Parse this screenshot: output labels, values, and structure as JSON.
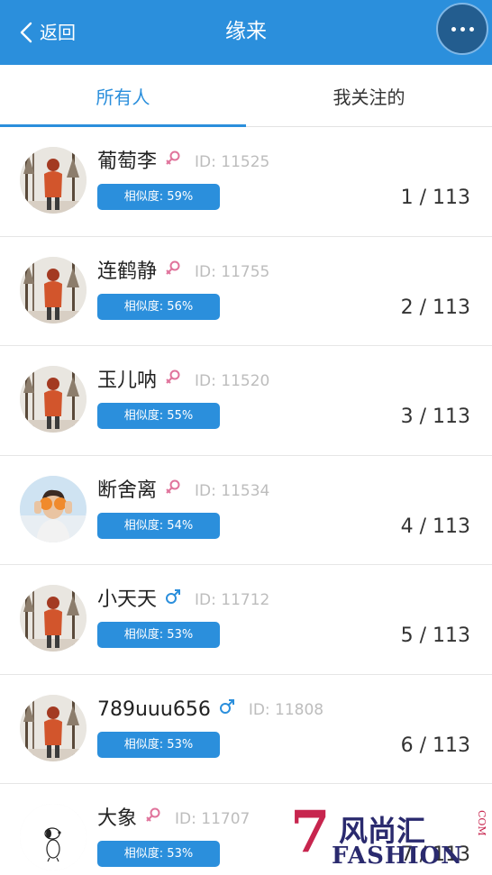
{
  "header": {
    "back_label": "返回",
    "title": "缘来"
  },
  "tabs": [
    {
      "label": "所有人",
      "active": true
    },
    {
      "label": "我关注的",
      "active": false
    }
  ],
  "users": [
    {
      "name": "葡萄李",
      "gender": "female",
      "id": "ID: 11525",
      "similarity": "相似度: 59%",
      "rank": "1 / 113",
      "avatar": "autumn-person"
    },
    {
      "name": "连鹤静",
      "gender": "female",
      "id": "ID: 11755",
      "similarity": "相似度: 56%",
      "rank": "2 / 113",
      "avatar": "autumn-person"
    },
    {
      "name": "玉儿呐",
      "gender": "female",
      "id": "ID: 11520",
      "similarity": "相似度: 55%",
      "rank": "3 / 113",
      "avatar": "autumn-person"
    },
    {
      "name": "断舍离",
      "gender": "female",
      "id": "ID: 11534",
      "similarity": "相似度: 54%",
      "rank": "4 / 113",
      "avatar": "woman-photo"
    },
    {
      "name": "小天天",
      "gender": "male",
      "id": "ID: 11712",
      "similarity": "相似度: 53%",
      "rank": "5 / 113",
      "avatar": "autumn-person"
    },
    {
      "name": "789uuu656",
      "gender": "male",
      "id": "ID: 11808",
      "similarity": "相似度: 53%",
      "rank": "6 / 113",
      "avatar": "autumn-person"
    },
    {
      "name": "大象",
      "gender": "female",
      "id": "ID: 11707",
      "similarity": "相似度: 53%",
      "rank": "7 / 113",
      "avatar": "snoopy"
    }
  ],
  "watermark": {
    "number": "7",
    "cn": "风尚汇",
    "en": "FASHION",
    "com": "COM"
  },
  "colors": {
    "primary": "#2b8fdc",
    "female": "#e0739b",
    "male": "#2b8fdc"
  }
}
